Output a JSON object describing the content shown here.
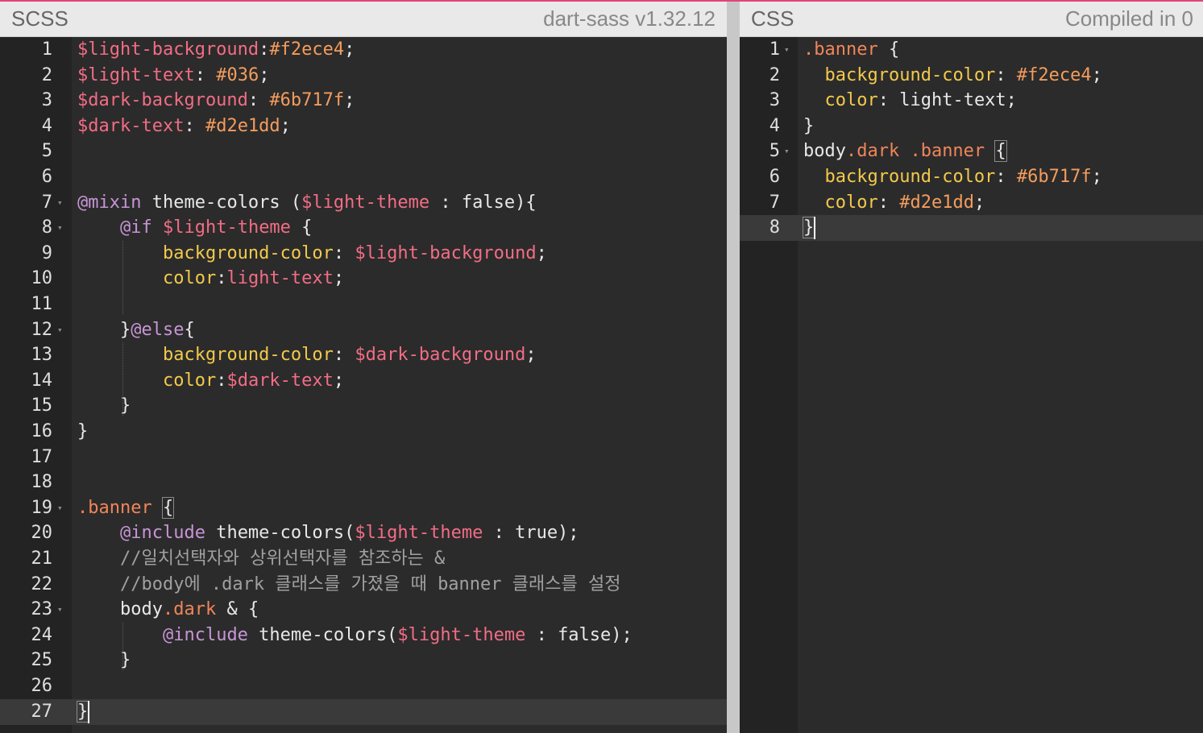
{
  "colors": {
    "accent": "#e0457b",
    "header_bg": "#e9e9e9",
    "editor_bg": "#2b2b2b",
    "gutter_bg": "#232323",
    "variable": "#f26d85",
    "at_rule": "#c795d6",
    "property": "#f2c94c",
    "selector": "#f0855a",
    "number": "#f49c5d",
    "comment": "#a0a0a0"
  },
  "scss_pane": {
    "title": "SCSS",
    "meta": "dart-sass v1.32.12",
    "active_line": 27,
    "lines": [
      {
        "n": "1",
        "fold": false,
        "tokens": [
          [
            "var",
            "$light-background"
          ],
          [
            "op",
            ":"
          ],
          [
            "num",
            "#f2ece4"
          ],
          [
            "op",
            ";"
          ]
        ]
      },
      {
        "n": "2",
        "fold": false,
        "tokens": [
          [
            "var",
            "$light-text"
          ],
          [
            "op",
            ": "
          ],
          [
            "num",
            "#036"
          ],
          [
            "op",
            ";"
          ]
        ]
      },
      {
        "n": "3",
        "fold": false,
        "tokens": [
          [
            "var",
            "$dark-background"
          ],
          [
            "op",
            ": "
          ],
          [
            "num",
            "#6b717f"
          ],
          [
            "op",
            ";"
          ]
        ]
      },
      {
        "n": "4",
        "fold": false,
        "tokens": [
          [
            "var",
            "$dark-text"
          ],
          [
            "op",
            ": "
          ],
          [
            "num",
            "#d2e1dd"
          ],
          [
            "op",
            ";"
          ]
        ]
      },
      {
        "n": "5",
        "fold": false,
        "tokens": []
      },
      {
        "n": "6",
        "fold": false,
        "tokens": []
      },
      {
        "n": "7",
        "fold": true,
        "tokens": [
          [
            "at",
            "@mixin"
          ],
          [
            "ident",
            " theme-colors ("
          ],
          [
            "var",
            "$light-theme"
          ],
          [
            "ident",
            " : false){"
          ]
        ]
      },
      {
        "n": "8",
        "fold": true,
        "tokens": [
          [
            "ident",
            "    "
          ],
          [
            "at",
            "@if"
          ],
          [
            "ident",
            " "
          ],
          [
            "var",
            "$light-theme"
          ],
          [
            "ident",
            " {"
          ]
        ]
      },
      {
        "n": "9",
        "fold": false,
        "tokens": [
          [
            "ident",
            "        "
          ],
          [
            "prop",
            "background-color"
          ],
          [
            "op",
            ": "
          ],
          [
            "var",
            "$light-background"
          ],
          [
            "op",
            ";"
          ]
        ]
      },
      {
        "n": "10",
        "fold": false,
        "tokens": [
          [
            "ident",
            "        "
          ],
          [
            "prop",
            "color"
          ],
          [
            "op",
            ":"
          ],
          [
            "var",
            "light-text"
          ],
          [
            "op",
            ";"
          ]
        ]
      },
      {
        "n": "11",
        "fold": false,
        "tokens": []
      },
      {
        "n": "12",
        "fold": true,
        "tokens": [
          [
            "ident",
            "    }"
          ],
          [
            "at",
            "@else"
          ],
          [
            "ident",
            "{"
          ]
        ]
      },
      {
        "n": "13",
        "fold": false,
        "tokens": [
          [
            "ident",
            "        "
          ],
          [
            "prop",
            "background-color"
          ],
          [
            "op",
            ": "
          ],
          [
            "var",
            "$dark-background"
          ],
          [
            "op",
            ";"
          ]
        ]
      },
      {
        "n": "14",
        "fold": false,
        "tokens": [
          [
            "ident",
            "        "
          ],
          [
            "prop",
            "color"
          ],
          [
            "op",
            ":"
          ],
          [
            "var",
            "$dark-text"
          ],
          [
            "op",
            ";"
          ]
        ]
      },
      {
        "n": "15",
        "fold": false,
        "tokens": [
          [
            "ident",
            "    }"
          ]
        ]
      },
      {
        "n": "16",
        "fold": false,
        "tokens": [
          [
            "ident",
            "}"
          ]
        ]
      },
      {
        "n": "17",
        "fold": false,
        "tokens": []
      },
      {
        "n": "18",
        "fold": false,
        "tokens": []
      },
      {
        "n": "19",
        "fold": true,
        "tokens": [
          [
            "sel",
            ".banner"
          ],
          [
            "ident",
            " "
          ],
          [
            "bracket",
            "{"
          ]
        ]
      },
      {
        "n": "20",
        "fold": false,
        "tokens": [
          [
            "ident",
            "    "
          ],
          [
            "at",
            "@include"
          ],
          [
            "ident",
            " theme-colors("
          ],
          [
            "var",
            "$light-theme"
          ],
          [
            "ident",
            " : true);"
          ]
        ]
      },
      {
        "n": "21",
        "fold": false,
        "tokens": [
          [
            "comment",
            "    //일치선택자와 상위선택자를 참조하는 &"
          ]
        ]
      },
      {
        "n": "22",
        "fold": false,
        "tokens": [
          [
            "comment",
            "    //body에 .dark 클래스를 가졌을 때 banner 클래스를 설정"
          ]
        ]
      },
      {
        "n": "23",
        "fold": true,
        "tokens": [
          [
            "ident",
            "    body"
          ],
          [
            "sel",
            ".dark"
          ],
          [
            "ident",
            " & {"
          ]
        ]
      },
      {
        "n": "24",
        "fold": false,
        "tokens": [
          [
            "ident",
            "        "
          ],
          [
            "at",
            "@include"
          ],
          [
            "ident",
            " theme-colors("
          ],
          [
            "var",
            "$light-theme"
          ],
          [
            "ident",
            " : false);"
          ]
        ]
      },
      {
        "n": "25",
        "fold": false,
        "tokens": [
          [
            "ident",
            "    }"
          ]
        ]
      },
      {
        "n": "26",
        "fold": false,
        "tokens": []
      },
      {
        "n": "27",
        "fold": false,
        "tokens": [
          [
            "bracket",
            "}"
          ]
        ]
      }
    ]
  },
  "css_pane": {
    "title": "CSS",
    "meta": "Compiled in 0",
    "active_line": 8,
    "lines": [
      {
        "n": "1",
        "fold": true,
        "tokens": [
          [
            "sel",
            ".banner"
          ],
          [
            "ident",
            " {"
          ]
        ]
      },
      {
        "n": "2",
        "fold": false,
        "tokens": [
          [
            "ident",
            "  "
          ],
          [
            "prop",
            "background-color"
          ],
          [
            "op",
            ": "
          ],
          [
            "num",
            "#f2ece4"
          ],
          [
            "op",
            ";"
          ]
        ]
      },
      {
        "n": "3",
        "fold": false,
        "tokens": [
          [
            "ident",
            "  "
          ],
          [
            "prop",
            "color"
          ],
          [
            "op",
            ": light-text;"
          ]
        ]
      },
      {
        "n": "4",
        "fold": false,
        "tokens": [
          [
            "ident",
            "}"
          ]
        ]
      },
      {
        "n": "5",
        "fold": true,
        "tokens": [
          [
            "ident",
            "body"
          ],
          [
            "sel",
            ".dark .banner"
          ],
          [
            "ident",
            " "
          ],
          [
            "bracket",
            "{"
          ]
        ]
      },
      {
        "n": "6",
        "fold": false,
        "tokens": [
          [
            "ident",
            "  "
          ],
          [
            "prop",
            "background-color"
          ],
          [
            "op",
            ": "
          ],
          [
            "num",
            "#6b717f"
          ],
          [
            "op",
            ";"
          ]
        ]
      },
      {
        "n": "7",
        "fold": false,
        "tokens": [
          [
            "ident",
            "  "
          ],
          [
            "prop",
            "color"
          ],
          [
            "op",
            ": "
          ],
          [
            "num",
            "#d2e1dd"
          ],
          [
            "op",
            ";"
          ]
        ]
      },
      {
        "n": "8",
        "fold": false,
        "tokens": [
          [
            "bracket",
            "}"
          ]
        ]
      }
    ]
  }
}
